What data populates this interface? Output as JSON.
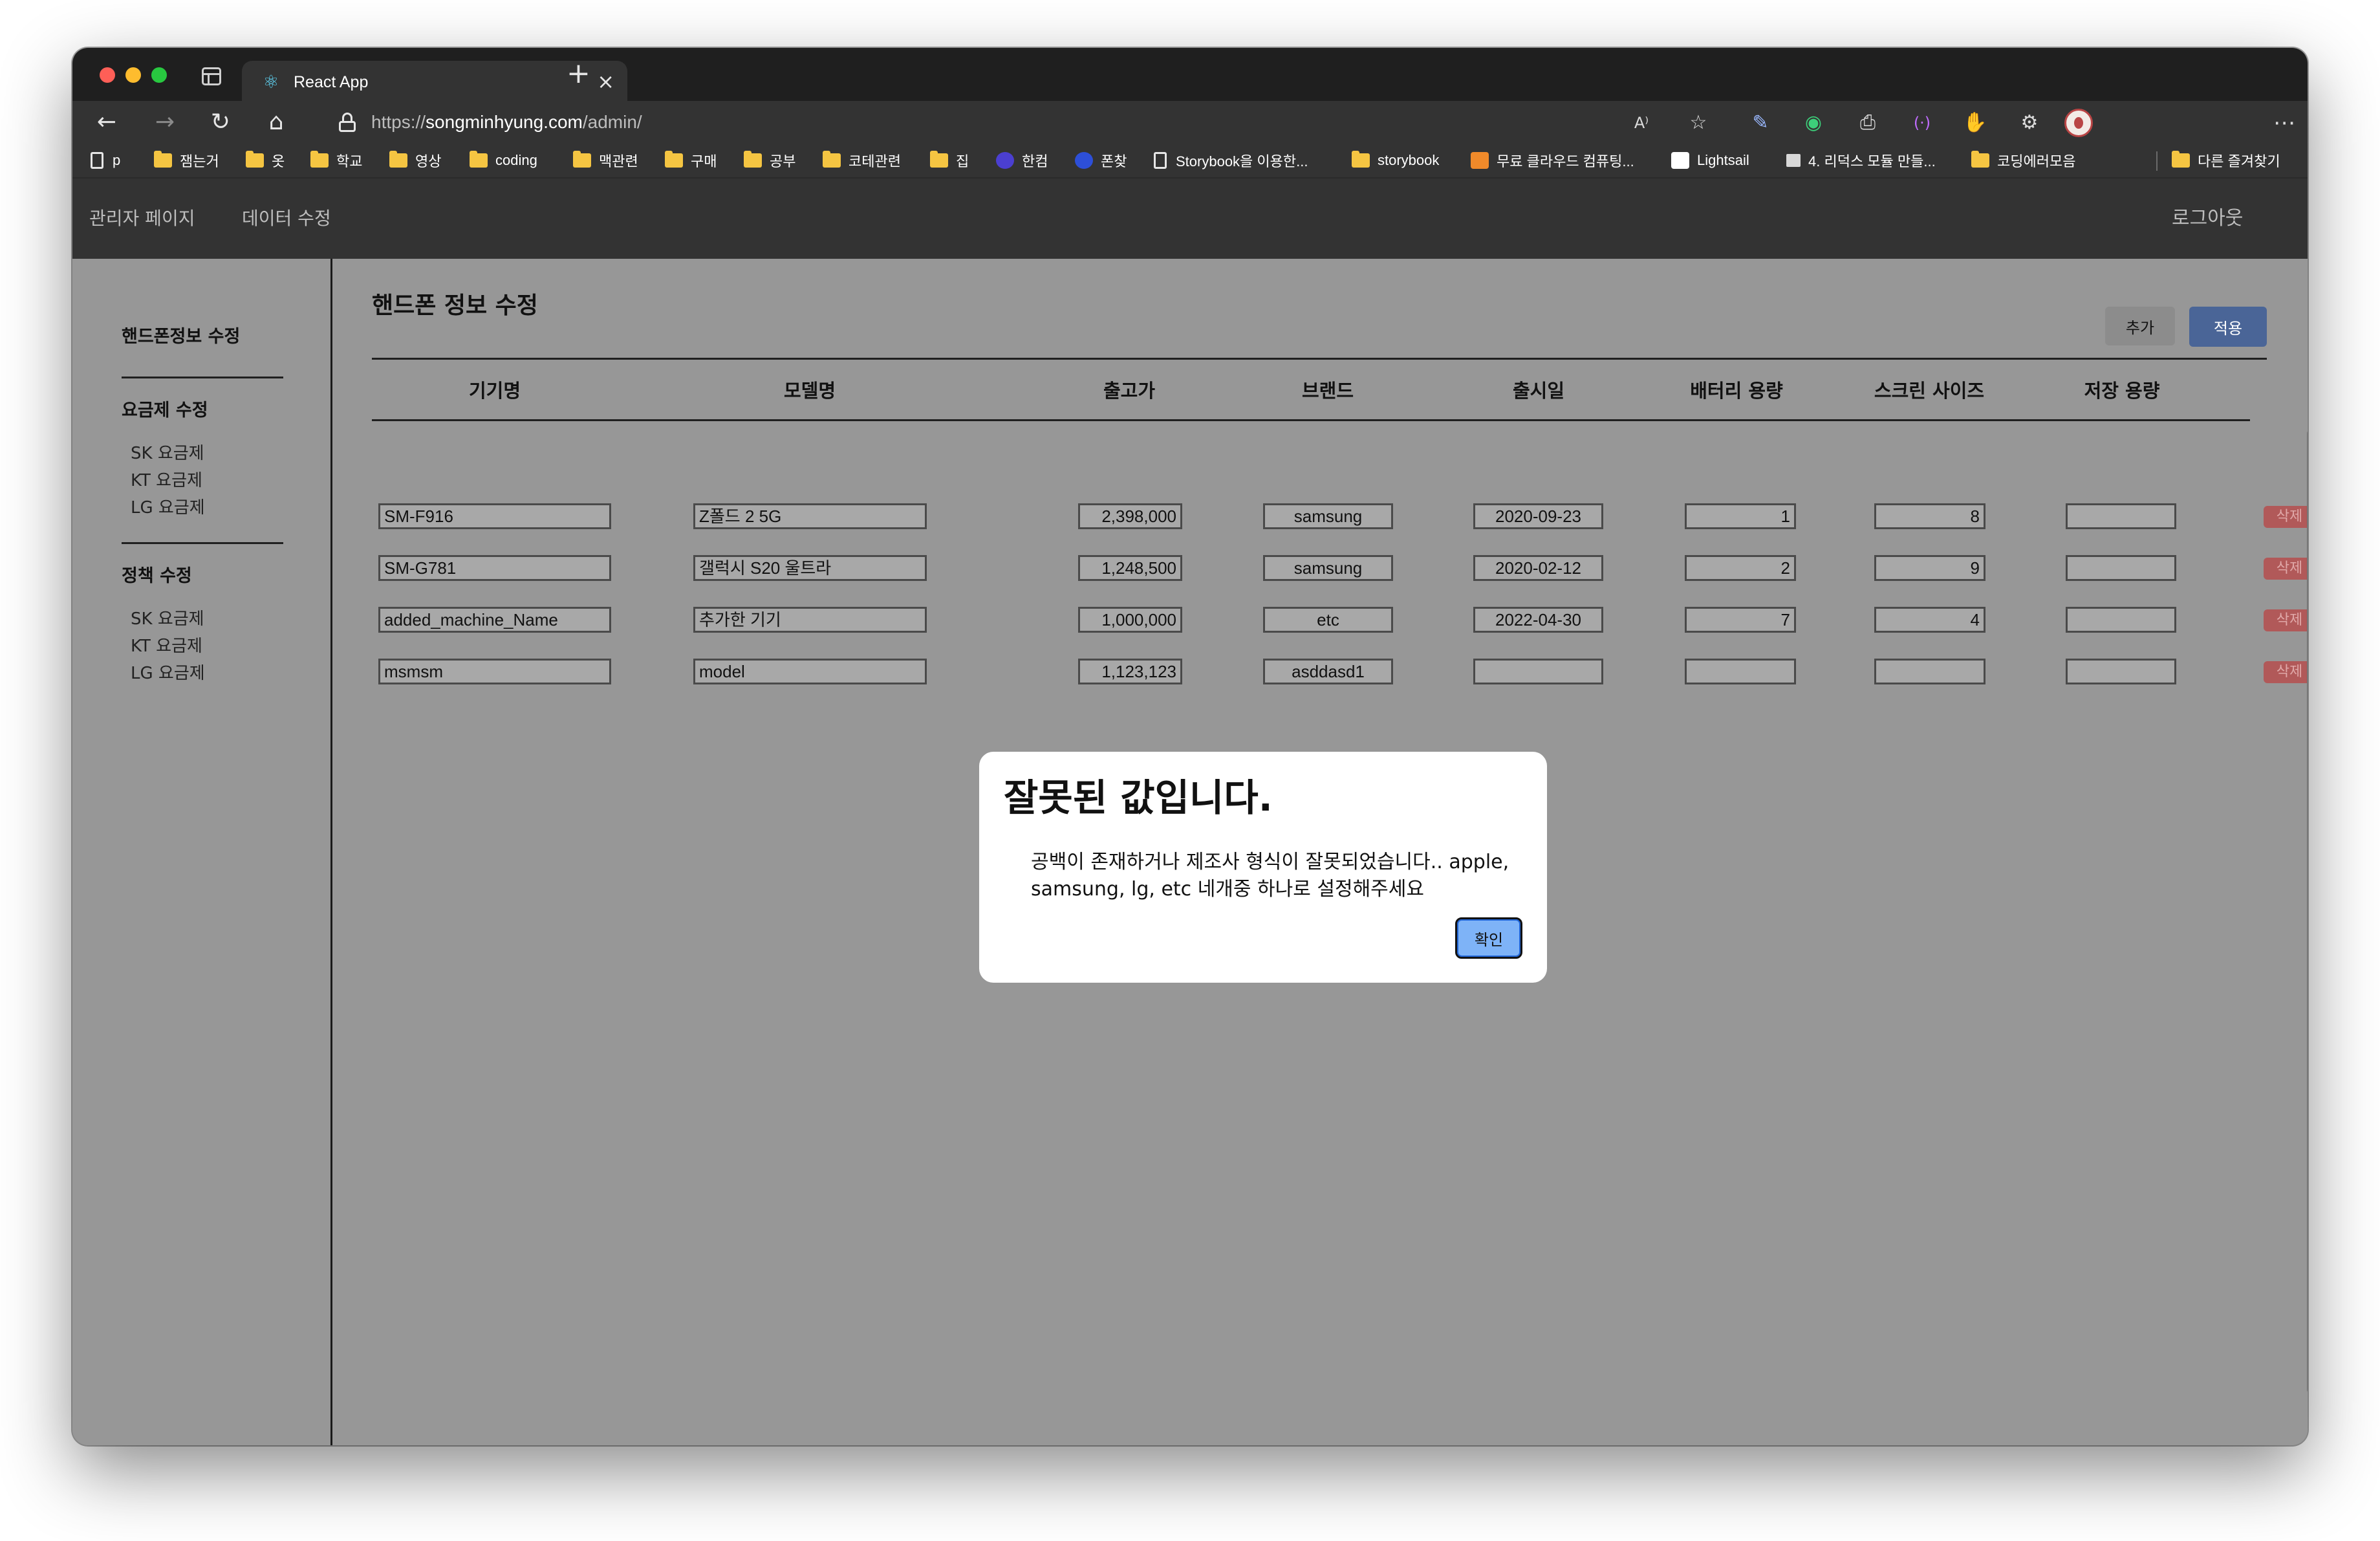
{
  "browser": {
    "tab_title": "React App",
    "tab_close": "×",
    "new_tab": "+",
    "url_prefix": "https://",
    "url_host": "songminhyung.com",
    "url_path": "/admin/",
    "bookmarks": [
      {
        "label": "p",
        "icon": "page-icon"
      },
      {
        "label": "잼는거",
        "icon": "folder-icon"
      },
      {
        "label": "옷",
        "icon": "folder-icon"
      },
      {
        "label": "학교",
        "icon": "folder-icon"
      },
      {
        "label": "영상",
        "icon": "folder-icon"
      },
      {
        "label": "coding",
        "icon": "folder-icon"
      },
      {
        "label": "맥관련",
        "icon": "folder-icon"
      },
      {
        "label": "구매",
        "icon": "folder-icon"
      },
      {
        "label": "공부",
        "icon": "folder-icon"
      },
      {
        "label": "코테관련",
        "icon": "folder-icon"
      },
      {
        "label": "집",
        "icon": "folder-icon"
      },
      {
        "label": "한컴",
        "icon": "hancom-icon"
      },
      {
        "label": "폰찾",
        "icon": "phone-find-icon"
      },
      {
        "label": "Storybook을 이용한...",
        "icon": "page-icon"
      },
      {
        "label": "storybook",
        "icon": "folder-icon"
      },
      {
        "label": "무료 클라우드 컴퓨팅...",
        "icon": "aws-icon"
      },
      {
        "label": "Lightsail",
        "icon": "amazon-icon"
      },
      {
        "label": "4. 리덕스 모듈 만들...",
        "icon": "book-icon"
      },
      {
        "label": "코딩에러모음",
        "icon": "folder-icon"
      },
      {
        "label": "다른 즐겨찾기",
        "icon": "folder-icon"
      }
    ]
  },
  "header": {
    "nav_admin": "관리자 페이지",
    "nav_data": "데이터 수정",
    "logout": "로그아웃"
  },
  "sidebar": {
    "phone_edit": "핸드폰정보 수정",
    "plan_section": "요금제 수정",
    "plan_items": [
      "SK 요금제",
      "KT 요금제",
      "LG 요금제"
    ],
    "policy_section": "정책 수정",
    "policy_items": [
      "SK 요금제",
      "KT 요금제",
      "LG 요금제"
    ]
  },
  "main": {
    "title": "핸드폰 정보 수정",
    "add_label": "추가",
    "apply_label": "적용",
    "delete_label": "삭제",
    "columns": [
      "기기명",
      "모델명",
      "출고가",
      "브랜드",
      "출시일",
      "배터리 용량",
      "스크린 사이즈",
      "저장 용량"
    ],
    "rows": [
      {
        "name": "SM-F916",
        "model": "Z폴드 2 5G",
        "price": "2,398,000",
        "brand": "samsung",
        "date": "2020-09-23",
        "battery": "1",
        "screen": "8",
        "storage": ""
      },
      {
        "name": "SM-G781",
        "model": "갤럭시 S20 울트라",
        "price": "1,248,500",
        "brand": "samsung",
        "date": "2020-02-12",
        "battery": "2",
        "screen": "9",
        "storage": ""
      },
      {
        "name": "added_machine_Name",
        "model": "추가한 기기",
        "price": "1,000,000",
        "brand": "etc",
        "date": "2022-04-30",
        "battery": "7",
        "screen": "4",
        "storage": ""
      },
      {
        "name": "msmsm",
        "model": "model",
        "price": "1,123,123",
        "brand": "asddasd1",
        "date": "",
        "battery": "",
        "screen": "",
        "storage": ""
      }
    ]
  },
  "dialog": {
    "title": "잘못된 값입니다.",
    "message": "공백이 존재하거나 제조사 형식이 잘못되었습니다.. apple, samsung, lg, etc 네개중 하나로 설정해주세요",
    "confirm_label": "확인"
  },
  "colors": {
    "window_chrome": "#333333",
    "page_background": "#979797",
    "apply_button": "#4a6597",
    "delete_button": "#b15959",
    "confirm_button": "#7eb3f7"
  }
}
